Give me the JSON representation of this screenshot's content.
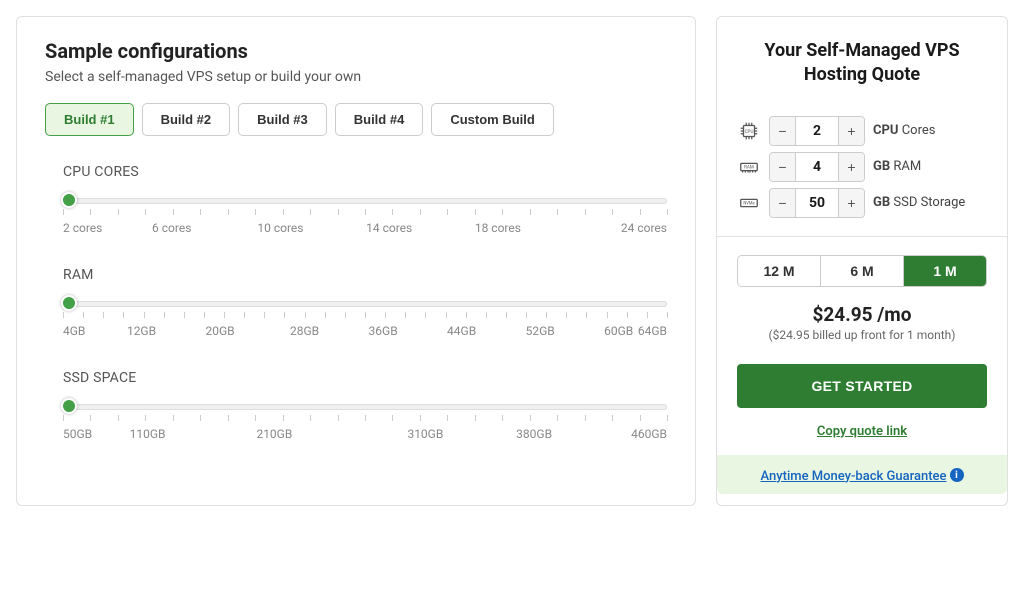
{
  "config": {
    "title": "Sample configurations",
    "subtitle": "Select a self-managed VPS setup or build your own",
    "builds": [
      "Build #1",
      "Build #2",
      "Build #3",
      "Build #4",
      "Custom Build"
    ],
    "active_build": 0,
    "sliders": {
      "cpu": {
        "label": "CPU CORES",
        "labels": [
          "2 cores",
          "6 cores",
          "10 cores",
          "14 cores",
          "18 cores",
          "24 cores"
        ],
        "tick_count": 23
      },
      "ram": {
        "label": "RAM",
        "labels": [
          "4GB",
          "12GB",
          "20GB",
          "28GB",
          "36GB",
          "44GB",
          "52GB",
          "60GB",
          "64GB"
        ],
        "tick_count": 31
      },
      "ssd": {
        "label": "SSD SPACE",
        "labels": [
          "50GB",
          "110GB",
          "210GB",
          "310GB",
          "380GB",
          "460GB"
        ],
        "tick_count": 23
      }
    }
  },
  "quote": {
    "title": "Your Self-Managed VPS Hosting Quote",
    "specs": {
      "cpu": {
        "value": "2",
        "label_bold": "CPU",
        "label_rest": " Cores"
      },
      "ram": {
        "value": "4",
        "label_bold": "GB",
        "label_rest": " RAM"
      },
      "ssd": {
        "value": "50",
        "label_bold": "GB",
        "label_rest": " SSD Storage"
      }
    },
    "terms": [
      "12 M",
      "6 M",
      "1 M"
    ],
    "active_term": 2,
    "price": "$24.95 /mo",
    "billed": "($24.95 billed up front for 1 month)",
    "cta": "GET STARTED",
    "copy_link": "Copy quote link",
    "guarantee": "Anytime Money-back Guarantee"
  }
}
